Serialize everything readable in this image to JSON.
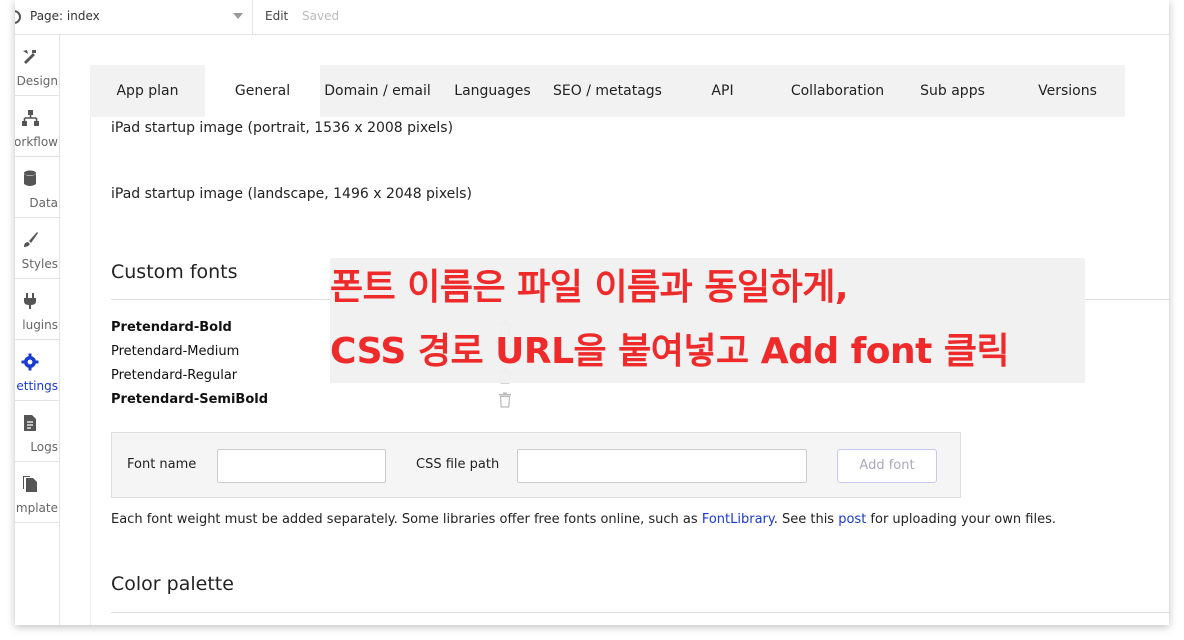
{
  "topbar": {
    "page_label": "Page: index",
    "edit_label": "Edit",
    "saved_label": "Saved"
  },
  "sidebar": {
    "items": [
      {
        "label": "Design",
        "icon": "design-icon"
      },
      {
        "label": "orkflow",
        "icon": "workflow-icon"
      },
      {
        "label": "Data",
        "icon": "data-icon"
      },
      {
        "label": "Styles",
        "icon": "brush-icon"
      },
      {
        "label": "lugins",
        "icon": "plug-icon"
      },
      {
        "label": "ettings",
        "icon": "gear-icon",
        "active": true
      },
      {
        "label": "Logs",
        "icon": "document-icon"
      },
      {
        "label": "mplate",
        "icon": "template-icon"
      }
    ],
    "active_color": "#1a3bd1"
  },
  "tabs": [
    "App plan",
    "General",
    "Domain / email",
    "Languages",
    "SEO / metatags",
    "API",
    "Collaboration",
    "Sub apps",
    "Versions"
  ],
  "active_tab": "General",
  "content": {
    "ipad_portrait": "iPad startup image (portrait, 1536 x 2008 pixels)",
    "ipad_landscape": "iPad startup image (landscape, 1496 x 2048 pixels)",
    "custom_fonts_title": "Custom fonts",
    "fonts": [
      {
        "name": "Pretendard-Bold",
        "bold": true
      },
      {
        "name": "Pretendard-Medium",
        "bold": false
      },
      {
        "name": "Pretendard-Regular",
        "bold": false
      },
      {
        "name": "Pretendard-SemiBold",
        "bold": true
      }
    ],
    "add_font": {
      "font_name_label": "Font name",
      "font_name_value": "",
      "css_path_label": "CSS file path",
      "css_path_value": "",
      "button_label": "Add font"
    },
    "note_prefix": "Each font weight must be added separately. Some libraries offer free fonts online, such as ",
    "note_link1": "FontLibrary",
    "note_middle": ". See this ",
    "note_link2": "post",
    "note_suffix": " for uploading your own files.",
    "color_palette_title": "Color palette"
  },
  "annotation": {
    "line1": "폰트 이름은 파일 이름과 동일하게,",
    "line2": "CSS 경로 URL을 붙여넣고 Add font 클릭",
    "color": "#ee2a2a"
  }
}
